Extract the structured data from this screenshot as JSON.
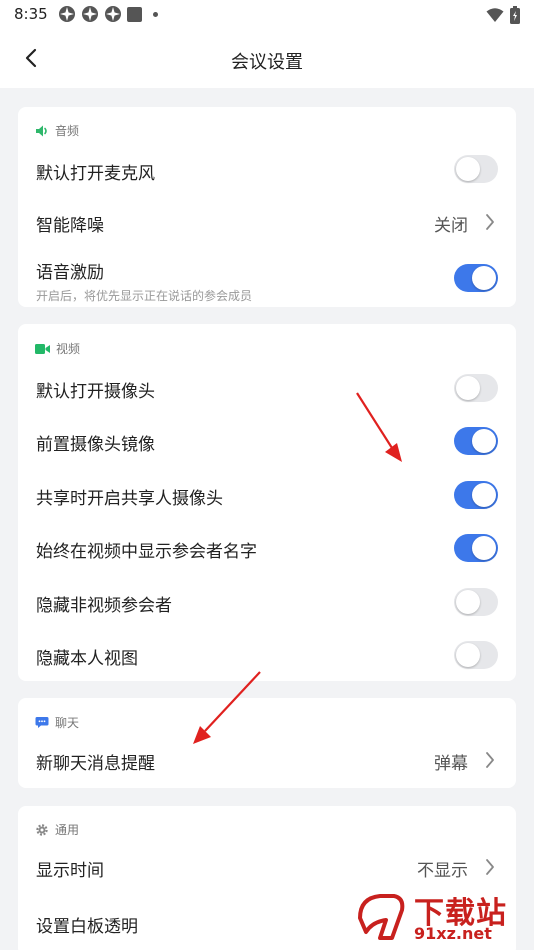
{
  "status_bar": {
    "time": "8:35",
    "notification_icons": [
      "app-icon",
      "app-icon",
      "app-icon",
      "square-icon",
      "dot-icon"
    ],
    "right_icons": [
      "wifi-icon",
      "battery-icon"
    ]
  },
  "header": {
    "title": "会议设置"
  },
  "audio": {
    "section_label": "音频",
    "default_mic_label": "默认打开麦克风",
    "default_mic_on": false,
    "noise_label": "智能降噪",
    "noise_value": "关闭",
    "voice_label": "语音激励",
    "voice_sub": "开启后，将优先显示正在说话的参会成员",
    "voice_on": true
  },
  "video": {
    "section_label": "视频",
    "default_camera_label": "默认打开摄像头",
    "default_camera_on": false,
    "mirror_label": "前置摄像头镜像",
    "mirror_on": true,
    "share_camera_label": "共享时开启共享人摄像头",
    "share_camera_on": true,
    "show_names_label": "始终在视频中显示参会者名字",
    "show_names_on": true,
    "hide_nonvideo_label": "隐藏非视频参会者",
    "hide_nonvideo_on": false,
    "hide_self_label": "隐藏本人视图",
    "hide_self_on": false
  },
  "chat": {
    "section_label": "聊天",
    "new_msg_label": "新聊天消息提醒",
    "new_msg_value": "弹幕"
  },
  "general": {
    "section_label": "通用",
    "show_time_label": "显示时间",
    "show_time_value": "不显示",
    "whiteboard_label": "设置白板透明"
  },
  "watermark": {
    "big_text": "下载站",
    "small_text": "91xz.net"
  },
  "colors": {
    "accent": "#3d78ea",
    "audio_icon": "#2fb76b",
    "video_icon": "#22b867",
    "chat_icon": "#3d78ea",
    "arrow": "#e0211f",
    "watermark": "#c8211e"
  }
}
